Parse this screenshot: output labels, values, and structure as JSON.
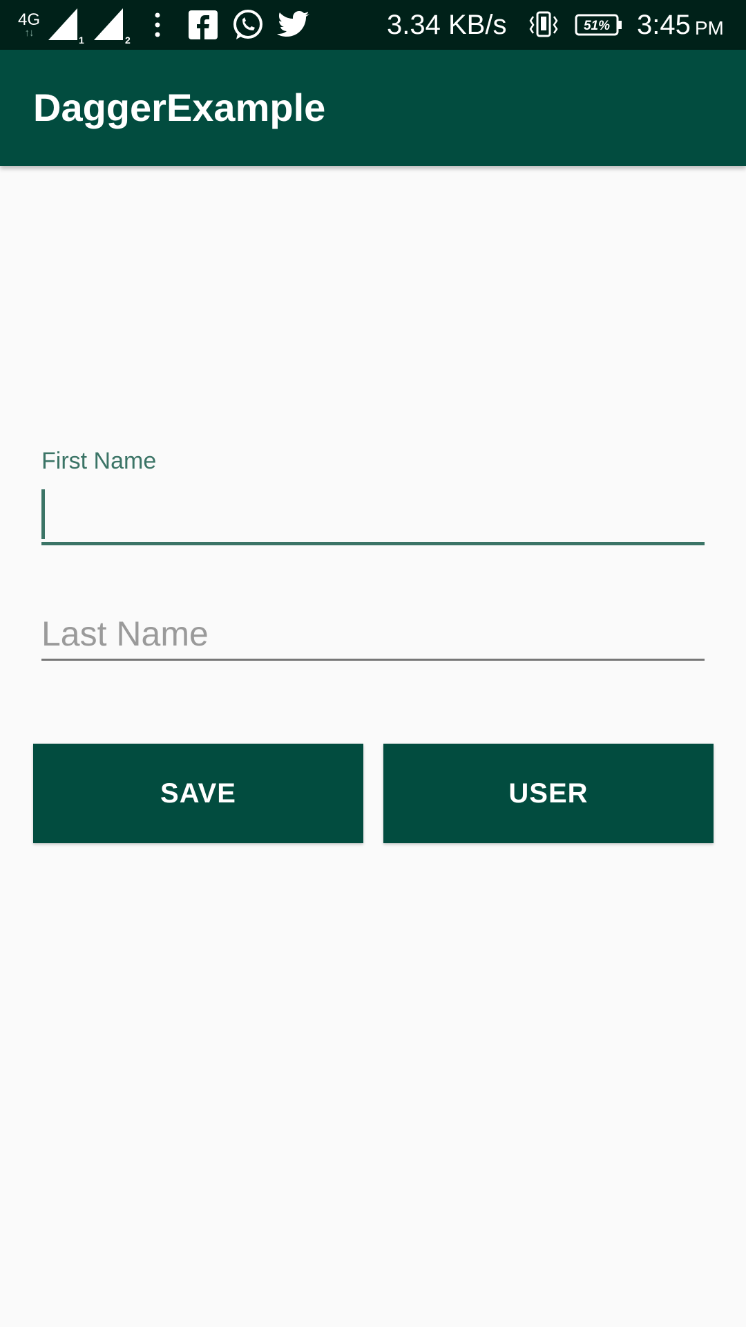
{
  "status_bar": {
    "network_type": "4G",
    "sim1": "1",
    "sim2": "2",
    "speed": "3.34 KB/s",
    "battery": "51%",
    "time": "3:45",
    "ampm": "PM",
    "icons": [
      "signal-sim1-icon",
      "signal-sim2-icon",
      "more-dots-icon",
      "facebook-icon",
      "whatsapp-icon",
      "twitter-icon",
      "vibrate-icon",
      "battery-icon"
    ]
  },
  "app_bar": {
    "title": "DaggerExample"
  },
  "form": {
    "first_name_label": "First Name",
    "first_name_value": "",
    "last_name_placeholder": "Last Name"
  },
  "buttons": {
    "save": "SAVE",
    "user": "USER"
  },
  "colors": {
    "primary": "#024c3f",
    "primary_dark": "#002119",
    "accent": "#3b7466",
    "background": "#fafafa"
  }
}
